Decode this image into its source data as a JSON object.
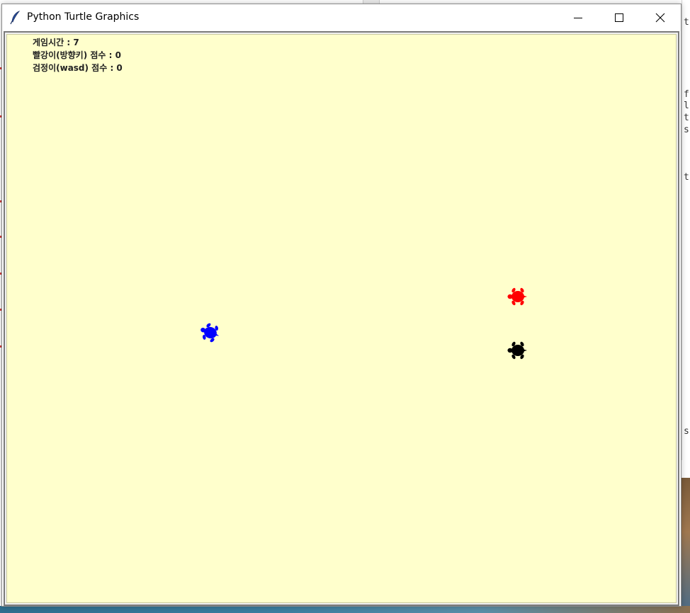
{
  "window": {
    "title": "Python Turtle Graphics",
    "controls": {
      "minimize": "minimize",
      "maximize": "maximize",
      "close": "close"
    }
  },
  "canvas": {
    "background": "#ffffcc"
  },
  "hud": {
    "time_label": "게임시간 : 7",
    "red_score_label": "빨강이(방향키) 점수 : 0",
    "black_score_label": "검정이(wasd) 점수 : 0"
  },
  "turtles": [
    {
      "name": "blue-turtle",
      "color": "#0000ff"
    },
    {
      "name": "red-turtle",
      "color": "#ff0000"
    },
    {
      "name": "black-turtle",
      "color": "#000000"
    }
  ],
  "background_window": {
    "fragments": [
      "t",
      "f",
      "l",
      "t",
      "s",
      "t",
      "s"
    ]
  },
  "icons": {
    "app": "feather-icon",
    "minimize": "minimize-icon",
    "maximize": "maximize-icon",
    "close": "close-icon"
  }
}
